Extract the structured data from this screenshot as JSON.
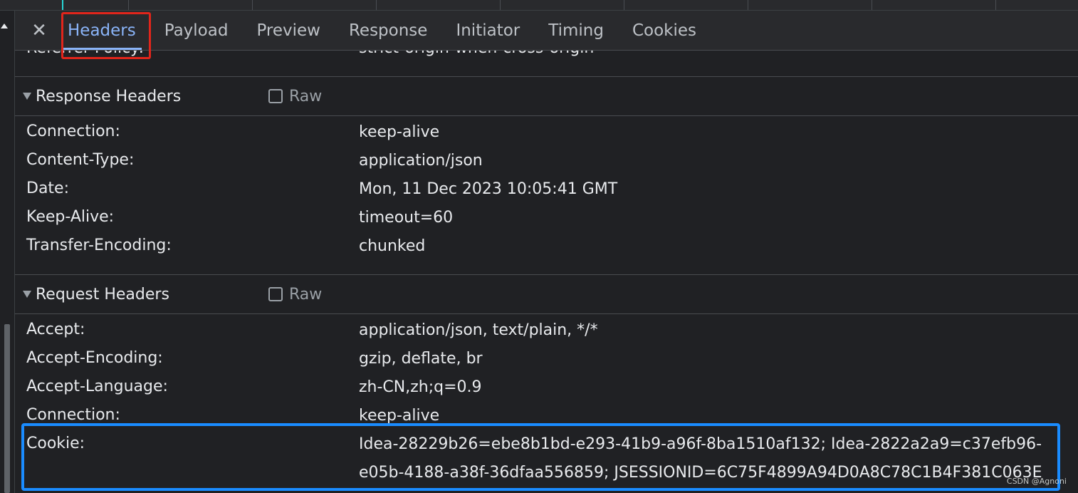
{
  "tabs": [
    {
      "label": "Headers",
      "active": true
    },
    {
      "label": "Payload"
    },
    {
      "label": "Preview"
    },
    {
      "label": "Response"
    },
    {
      "label": "Initiator"
    },
    {
      "label": "Timing"
    },
    {
      "label": "Cookies"
    }
  ],
  "close_icon": "✕",
  "partial_row": {
    "name": "Referrer Policy:",
    "value": "strict-origin-when-cross-origin"
  },
  "response_headers": {
    "title": "Response Headers",
    "raw_label": "Raw",
    "rows": [
      {
        "name": "Connection:",
        "value": "keep-alive"
      },
      {
        "name": "Content-Type:",
        "value": "application/json"
      },
      {
        "name": "Date:",
        "value": "Mon, 11 Dec 2023 10:05:41 GMT"
      },
      {
        "name": "Keep-Alive:",
        "value": "timeout=60"
      },
      {
        "name": "Transfer-Encoding:",
        "value": "chunked"
      }
    ]
  },
  "request_headers": {
    "title": "Request Headers",
    "raw_label": "Raw",
    "rows": [
      {
        "name": "Accept:",
        "value": "application/json, text/plain, */*"
      },
      {
        "name": "Accept-Encoding:",
        "value": "gzip, deflate, br"
      },
      {
        "name": "Accept-Language:",
        "value": "zh-CN,zh;q=0.9"
      },
      {
        "name": "Connection:",
        "value": "keep-alive"
      },
      {
        "name": "Cookie:",
        "value": "Idea-28229b26=ebe8b1bd-e293-41b9-a96f-8ba1510af132; Idea-2822a2a9=c37efb96-e05b-4188-a38f-36dfaa556859; JSESSIONID=6C75F4899A94D0A8C78C1B4F381C063E"
      }
    ]
  },
  "watermark": "CSDN @Agnoni",
  "colors": {
    "highlight_red": "#e1251b",
    "highlight_blue": "#1a8cff",
    "active_tab": "#8ab4f8"
  }
}
